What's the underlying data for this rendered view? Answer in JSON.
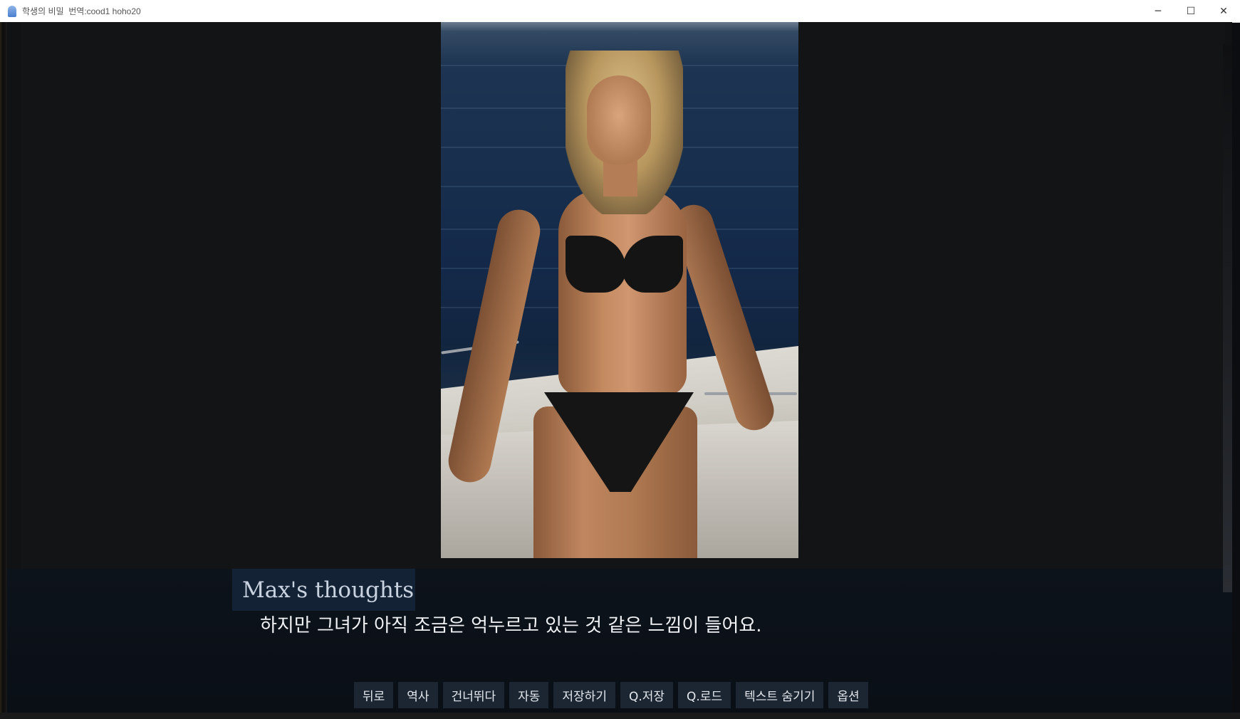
{
  "window": {
    "title": "학생의 비밀  번역:cood1 hoho20",
    "controls": {
      "minimize": "─",
      "maximize": "☐",
      "close": "✕"
    }
  },
  "scene": {
    "icon": "bikini-model-on-boat"
  },
  "dialogue": {
    "speaker": "Max's thoughts",
    "text": "하지만 그녀가 아직 조금은 억누르고 있는 것 같은 느낌이 들어요."
  },
  "quick_menu": [
    {
      "id": "back",
      "label": "뒤로"
    },
    {
      "id": "history",
      "label": "역사"
    },
    {
      "id": "skip",
      "label": "건너뛰다"
    },
    {
      "id": "auto",
      "label": "자동"
    },
    {
      "id": "save",
      "label": "저장하기"
    },
    {
      "id": "qsave",
      "label": "Q.저장"
    },
    {
      "id": "qload",
      "label": "Q.로드"
    },
    {
      "id": "hide",
      "label": "텍스트 숨기기"
    },
    {
      "id": "prefs",
      "label": "옵션"
    }
  ],
  "colors": {
    "dialogue_bg": "#0b1018",
    "namebox_bg": "#142236",
    "button_bg": "#1c2532"
  }
}
